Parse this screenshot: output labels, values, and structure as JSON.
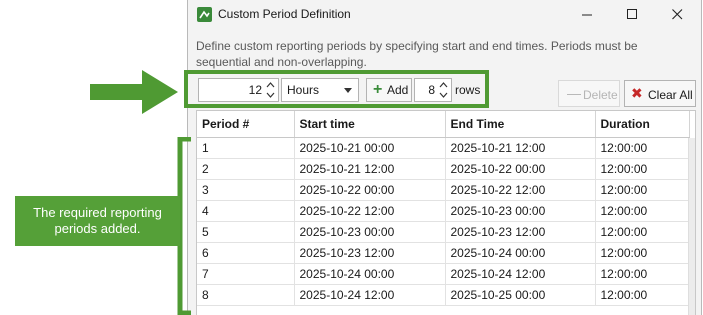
{
  "window": {
    "title": "Custom Period Definition",
    "description": "Define custom reporting periods by specifying start and end times. Periods must be sequential and non-overlapping."
  },
  "toolbar": {
    "interval_value": "12",
    "unit_selected": "Hours",
    "add_label": "Add",
    "rows_value": "8",
    "rows_label": "rows",
    "delete_label": "Delete",
    "clear_all_label": "Clear All"
  },
  "grid": {
    "columns": [
      "Period #",
      "Start time",
      "End Time",
      "Duration"
    ],
    "rows": [
      [
        "1",
        "2025-10-21 00:00",
        "2025-10-21 12:00",
        "12:00:00"
      ],
      [
        "2",
        "2025-10-21 12:00",
        "2025-10-22 00:00",
        "12:00:00"
      ],
      [
        "3",
        "2025-10-22 00:00",
        "2025-10-22 12:00",
        "12:00:00"
      ],
      [
        "4",
        "2025-10-22 12:00",
        "2025-10-23 00:00",
        "12:00:00"
      ],
      [
        "5",
        "2025-10-23 00:00",
        "2025-10-23 12:00",
        "12:00:00"
      ],
      [
        "6",
        "2025-10-23 12:00",
        "2025-10-24 00:00",
        "12:00:00"
      ],
      [
        "7",
        "2025-10-24 00:00",
        "2025-10-24 12:00",
        "12:00:00"
      ],
      [
        "8",
        "2025-10-24 12:00",
        "2025-10-25 00:00",
        "12:00:00"
      ]
    ]
  },
  "annotation": {
    "callout_text": "The required reporting periods added."
  },
  "colors": {
    "annotation_green": "#4f9a33",
    "clear_icon_red": "#c62828",
    "add_icon_green": "#3c8d3c"
  },
  "icons": {
    "app": "app-logo-icon",
    "minimize": "minimize-icon",
    "maximize": "maximize-icon",
    "close": "close-icon",
    "add": "plus-icon",
    "delete": "minus-icon",
    "clear": "x-icon"
  }
}
